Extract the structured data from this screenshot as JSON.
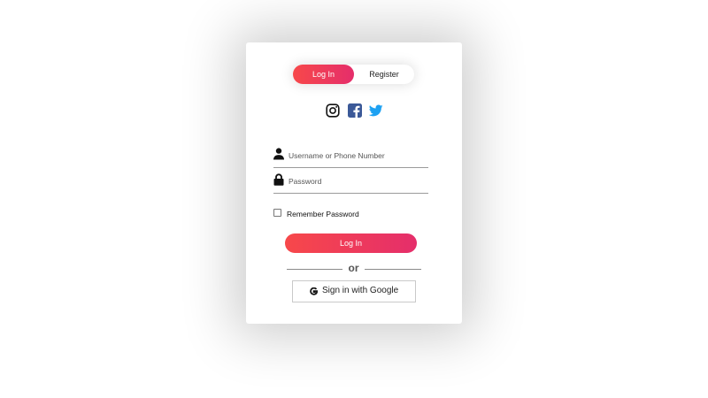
{
  "tabs": {
    "login": "Log In",
    "register": "Register",
    "active": "login"
  },
  "social_icons": [
    "instagram-icon",
    "facebook-icon",
    "twitter-icon"
  ],
  "colors": {
    "accent_start": "#f7484a",
    "accent_end": "#e52e6b",
    "facebook": "#3b5998",
    "twitter": "#1da1f2"
  },
  "form": {
    "username_placeholder": "Username or Phone Number",
    "username_value": "",
    "password_placeholder": "Password",
    "password_value": "",
    "remember_label": "Remember Password",
    "remember_checked": false,
    "submit_label": "Log In"
  },
  "divider_text": "or",
  "google_button": {
    "label": "Sign in with Google",
    "icon": "google-icon"
  }
}
